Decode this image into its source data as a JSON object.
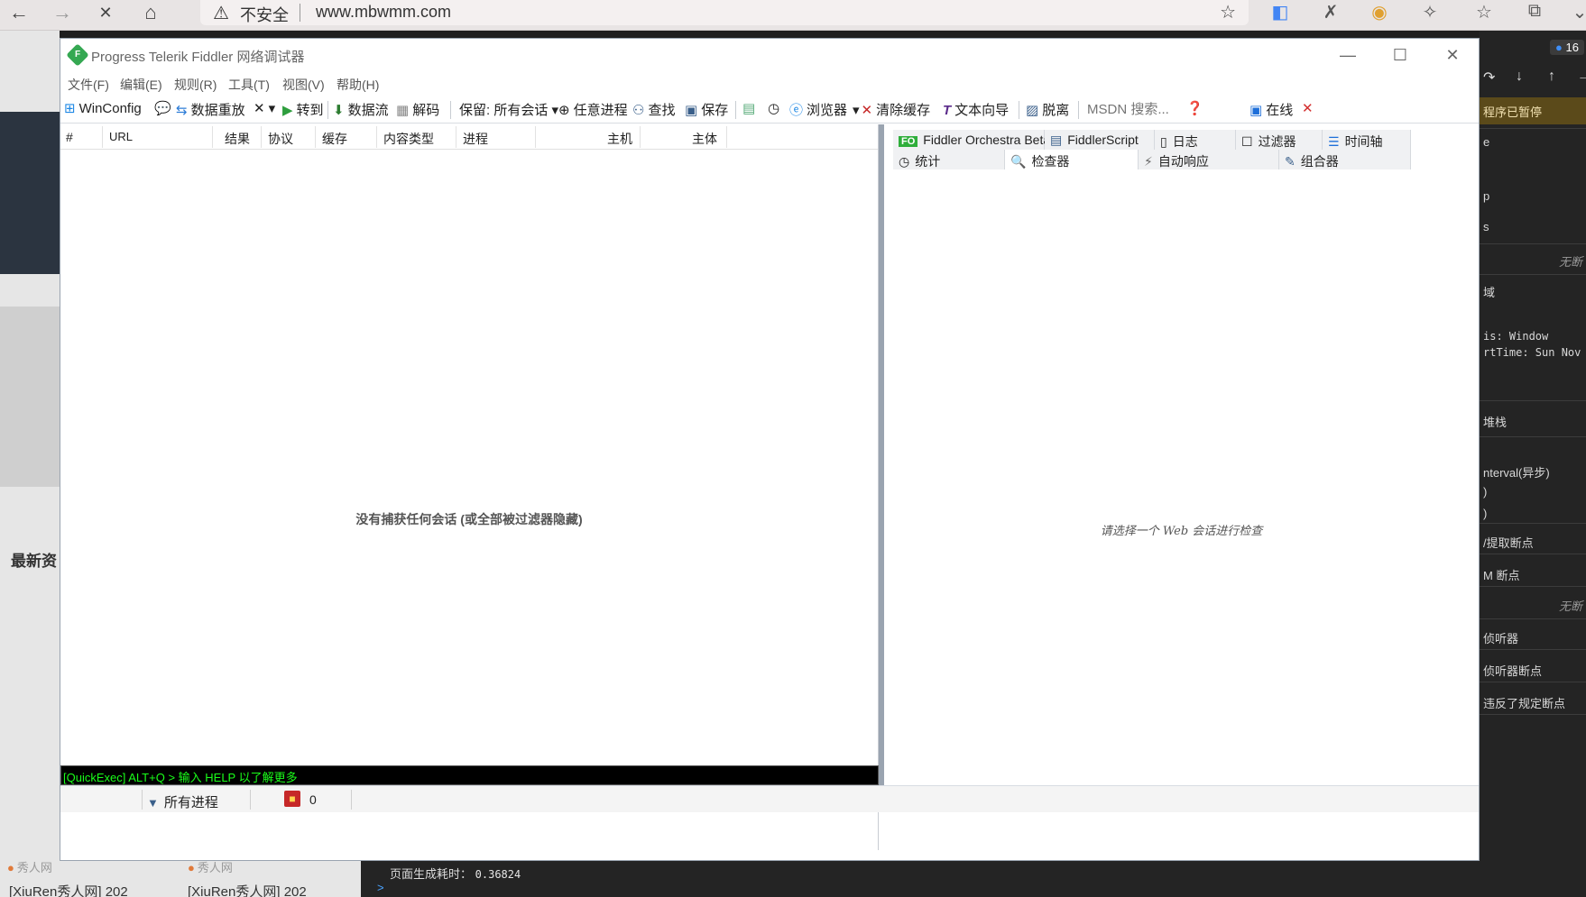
{
  "browser": {
    "nav_back": "←",
    "nav_forward": "→",
    "nav_close": "✕",
    "nav_home": "⌂",
    "warning_icon": "warning-triangle-icon",
    "insecure_label": "不安全",
    "url": "www.mbwmm.com"
  },
  "background_page": {
    "latest_heading": "最新资",
    "items": [
      {
        "source": "秀人网",
        "title": "[XiuRen秀人网] 202"
      },
      {
        "source": "秀人网",
        "title": "[XiuRen秀人网] 202"
      }
    ]
  },
  "devtools": {
    "badge": "16",
    "paused_label": "程序已暂停",
    "lines": [
      {
        "text": "e",
        "mono": false
      },
      {
        "text": "p",
        "mono": false
      },
      {
        "text": "s",
        "mono": false
      },
      {
        "text": "无断",
        "italic": true
      },
      {
        "text": "域",
        "mono": false
      },
      {
        "text": "is: Window",
        "mono": true
      },
      {
        "text": "rtTime: Sun Nov",
        "mono": true
      },
      {
        "text": "堆栈",
        "mono": false
      },
      {
        "text": "nterval(异步)",
        "mono": false
      },
      {
        "text": ")",
        "mono": false
      },
      {
        "text": ")",
        "mono": false
      },
      {
        "text": "/提取断点",
        "mono": false
      },
      {
        "text": "M 断点",
        "mono": false
      },
      {
        "text": "无断",
        "italic": true
      },
      {
        "text": "侦听器",
        "mono": false
      },
      {
        "text": "侦听器断点",
        "mono": false
      },
      {
        "text": "违反了规定断点",
        "mono": false
      }
    ],
    "console_label": "页面生成耗时：",
    "console_value": "0.36824",
    "console_prompt": ">"
  },
  "fiddler": {
    "title": "Progress Telerik Fiddler 网络调试器",
    "menu": [
      "文件(F)",
      "编辑(E)",
      "规则(R)",
      "工具(T)",
      "视图(V)",
      "帮助(H)"
    ],
    "toolbar": {
      "winconfig": "WinConfig",
      "replay": "数据重放",
      "goto": "转到",
      "stream": "数据流",
      "decode": "解码",
      "keep": "保留: 所有会话",
      "any_process": "任意进程",
      "find": "查找",
      "save": "保存",
      "browse": "浏览器",
      "clear_cache": "清除缓存",
      "text_wizard": "文本向导",
      "tearoff": "脱离",
      "msdn_placeholder": "MSDN 搜索...",
      "online": "在线"
    },
    "columns": [
      "#",
      "URL",
      "结果",
      "协议",
      "缓存",
      "内容类型",
      "进程",
      "主机",
      "主体"
    ],
    "empty_message": "没有捕获任何会话 (或全部被过滤器隐藏)",
    "quickexec": "[QuickExec] ALT+Q > 输入 HELP 以了解更多",
    "tabs_row1": [
      "Fiddler Orchestra Beta",
      "FiddlerScript",
      "日志",
      "过滤器",
      "时间轴"
    ],
    "tabs_row2": [
      "统计",
      "检查器",
      "自动响应",
      "组合器"
    ],
    "fo_badge": "FO",
    "inspector_message": "请选择一个 Web 会话进行检查",
    "status": {
      "process_filter": "所有进程",
      "count": "0"
    }
  }
}
